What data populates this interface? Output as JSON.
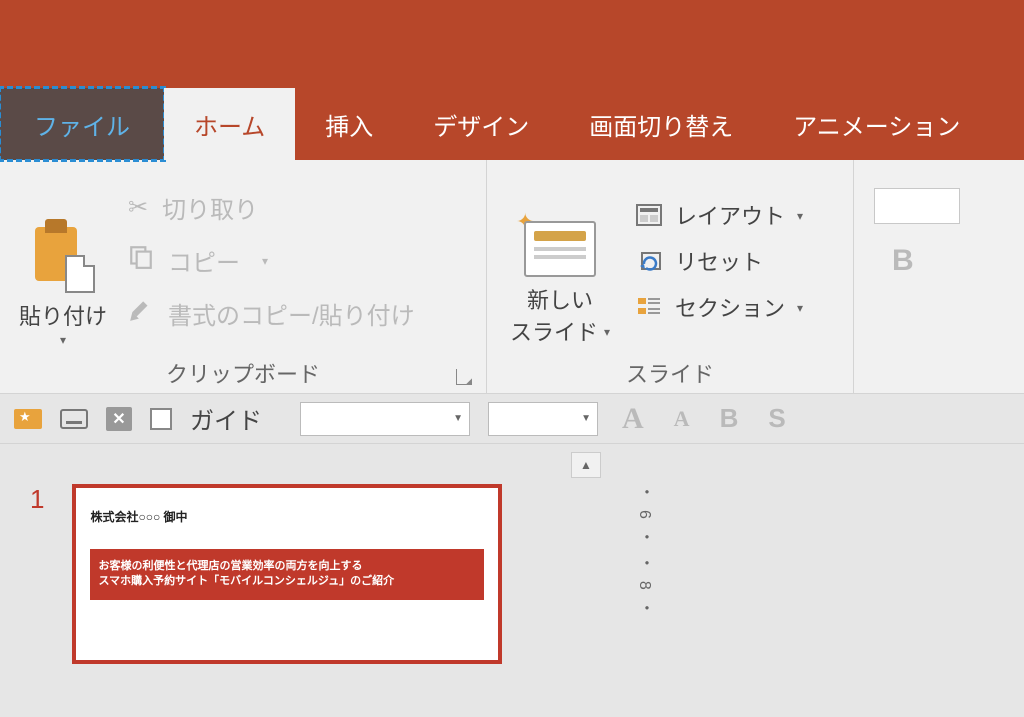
{
  "tabs": {
    "file": "ファイル",
    "home": "ホーム",
    "insert": "挿入",
    "design": "デザイン",
    "transitions": "画面切り替え",
    "animations": "アニメーション"
  },
  "ribbon": {
    "clipboard": {
      "paste": "貼り付け",
      "cut": "切り取り",
      "copy": "コピー",
      "format_painter": "書式のコピー/貼り付け",
      "group_label": "クリップボード"
    },
    "slides": {
      "new_slide_line1": "新しい",
      "new_slide_line2": "スライド",
      "layout": "レイアウト",
      "reset": "リセット",
      "section": "セクション",
      "group_label": "スライド"
    },
    "font": {
      "bold": "B"
    }
  },
  "quick_access": {
    "guide": "ガイド",
    "font_increase": "A",
    "font_decrease": "A",
    "bold": "B",
    "strike": "S"
  },
  "slide_panel": {
    "number": "1",
    "company": "株式会社○○○ 御中",
    "banner_line1": "お客様の利便性と代理店の営業効率の両方を向上する",
    "banner_line2": "スマホ購入予約サイト「モバイルコンシェルジュ」のご紹介"
  },
  "ruler": {
    "marks": "・6・・8・"
  }
}
